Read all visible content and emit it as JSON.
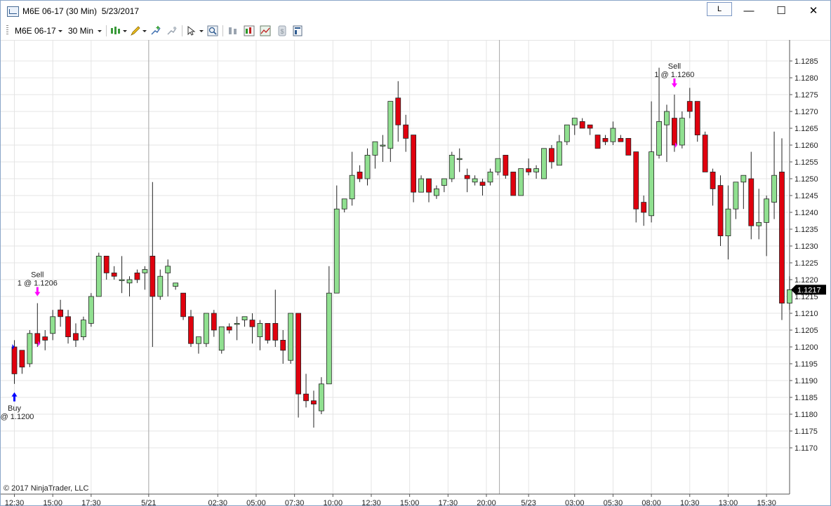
{
  "window": {
    "title": "M6E 06-17 (30 Min)  5/23/2017",
    "link_button": "L",
    "minimize": "—",
    "maximize": "☐",
    "close": "✕"
  },
  "toolbar": {
    "instrument": "M6E 06-17",
    "interval": "30 Min",
    "icons": [
      "chart-style-icon",
      "drawing-tool-icon",
      "add-indicator-icon",
      "strategy-icon",
      "cursor-icon",
      "zoom-icon",
      "bar-spacing-icon",
      "data-series-icon",
      "templates-icon",
      "trade-icon",
      "properties-icon"
    ]
  },
  "copyright": "© 2017 NinjaTrader, LLC",
  "colors": {
    "up": "#90e090",
    "down": "#e0000e",
    "outline": "#222222",
    "grid": "#e4e4e4",
    "marker_sell": "#ff00ff",
    "marker_buy": "#0000ff"
  },
  "chart_data": {
    "type": "candlestick",
    "title": "",
    "xlabel": "",
    "ylabel": "",
    "ylim": [
      1.1168,
      1.1292
    ],
    "y_ticks": [
      "1.1285",
      "1.1280",
      "1.1275",
      "1.1270",
      "1.1265",
      "1.1260",
      "1.1255",
      "1.1250",
      "1.1245",
      "1.1240",
      "1.1235",
      "1.1230",
      "1.1225",
      "1.1220",
      "1.1215",
      "1.1210",
      "1.1205",
      "1.1200",
      "1.1195",
      "1.1190",
      "1.1185",
      "1.1180",
      "1.1175",
      "1.1170"
    ],
    "x_ticks": [
      "12:30",
      "15:00",
      "17:30",
      "5/21",
      "02:30",
      "05:00",
      "07:30",
      "10:00",
      "12:30",
      "15:00",
      "17:30",
      "20:00",
      "5/23",
      "03:00",
      "05:30",
      "08:00",
      "10:30",
      "13:00",
      "15:30"
    ],
    "current_price": "1.1217",
    "candles": [
      [
        1.12,
        1.1202,
        1.1189,
        1.1192
      ],
      [
        1.1199,
        1.1199,
        1.1192,
        1.1194
      ],
      [
        1.1195,
        1.1205,
        1.1194,
        1.1204
      ],
      [
        1.1204,
        1.1213,
        1.12,
        1.1201
      ],
      [
        1.1203,
        1.1205,
        1.1199,
        1.1202
      ],
      [
        1.1204,
        1.1211,
        1.1202,
        1.1209
      ],
      [
        1.1211,
        1.1214,
        1.1206,
        1.1209
      ],
      [
        1.1209,
        1.1211,
        1.1201,
        1.1203
      ],
      [
        1.1204,
        1.1207,
        1.12,
        1.1202
      ],
      [
        1.1203,
        1.1209,
        1.1202,
        1.1208
      ],
      [
        1.1207,
        1.1216,
        1.1206,
        1.1215
      ],
      [
        1.1215,
        1.1228,
        1.1215,
        1.1227
      ],
      [
        1.1227,
        1.1227,
        1.122,
        1.1222
      ],
      [
        1.1222,
        1.1224,
        1.122,
        1.1221
      ],
      [
        1.122,
        1.1227,
        1.1216,
        1.122
      ],
      [
        1.1219,
        1.1221,
        1.1215,
        1.122
      ],
      [
        1.1222,
        1.1223,
        1.1219,
        1.122
      ],
      [
        1.1222,
        1.1224,
        1.1217,
        1.1223
      ],
      [
        1.1227,
        1.1249,
        1.12,
        1.1215
      ],
      [
        1.1215,
        1.1223,
        1.1214,
        1.1221
      ],
      [
        1.1222,
        1.1226,
        1.1215,
        1.1224
      ],
      [
        1.1218,
        1.1219,
        1.1217,
        1.1219
      ],
      [
        1.1216,
        1.1216,
        1.1208,
        1.1209
      ],
      [
        1.1209,
        1.1211,
        1.12,
        1.1201
      ],
      [
        1.1201,
        1.1203,
        1.1198,
        1.1203
      ],
      [
        1.1201,
        1.121,
        1.12,
        1.121
      ],
      [
        1.121,
        1.1211,
        1.1203,
        1.1205
      ],
      [
        1.1199,
        1.1205,
        1.1198,
        1.1206
      ],
      [
        1.1206,
        1.1207,
        1.1204,
        1.1205
      ],
      [
        1.1207,
        1.1209,
        1.1202,
        1.1207
      ],
      [
        1.1208,
        1.1209,
        1.1206,
        1.1209
      ],
      [
        1.1208,
        1.121,
        1.1201,
        1.1206
      ],
      [
        1.1203,
        1.1208,
        1.1199,
        1.1207
      ],
      [
        1.1207,
        1.1207,
        1.1201,
        1.1202
      ],
      [
        1.1207,
        1.1217,
        1.12,
        1.1202
      ],
      [
        1.1202,
        1.1205,
        1.1195,
        1.1199
      ],
      [
        1.1196,
        1.121,
        1.1195,
        1.121
      ],
      [
        1.121,
        1.121,
        1.1179,
        1.1186
      ],
      [
        1.1186,
        1.1192,
        1.1182,
        1.1184
      ],
      [
        1.1184,
        1.1187,
        1.1176,
        1.1183
      ],
      [
        1.1181,
        1.1191,
        1.118,
        1.1189
      ],
      [
        1.1189,
        1.1224,
        1.1189,
        1.1216
      ],
      [
        1.1216,
        1.1248,
        1.1216,
        1.1241
      ],
      [
        1.1241,
        1.1244,
        1.124,
        1.1244
      ],
      [
        1.1244,
        1.1258,
        1.1242,
        1.1251
      ],
      [
        1.1252,
        1.1254,
        1.1249,
        1.125
      ],
      [
        1.125,
        1.1259,
        1.1248,
        1.1257
      ],
      [
        1.1257,
        1.1261,
        1.1253,
        1.1261
      ],
      [
        1.126,
        1.1263,
        1.1255,
        1.126
      ],
      [
        1.1259,
        1.1273,
        1.1255,
        1.1273
      ],
      [
        1.1274,
        1.1279,
        1.1261,
        1.1266
      ],
      [
        1.1266,
        1.1269,
        1.1258,
        1.1262
      ],
      [
        1.1263,
        1.1263,
        1.1243,
        1.1246
      ],
      [
        1.1246,
        1.1251,
        1.1246,
        1.125
      ],
      [
        1.125,
        1.125,
        1.1243,
        1.1246
      ],
      [
        1.1245,
        1.1248,
        1.1244,
        1.1247
      ],
      [
        1.1248,
        1.125,
        1.1246,
        1.125
      ],
      [
        1.125,
        1.1258,
        1.1249,
        1.1257
      ],
      [
        1.1256,
        1.1259,
        1.1252,
        1.1256
      ],
      [
        1.1251,
        1.1253,
        1.1246,
        1.125
      ],
      [
        1.1249,
        1.1251,
        1.1248,
        1.125
      ],
      [
        1.1249,
        1.125,
        1.1245,
        1.1248
      ],
      [
        1.1249,
        1.1253,
        1.1248,
        1.1252
      ],
      [
        1.1252,
        1.1256,
        1.1251,
        1.1256
      ],
      [
        1.1257,
        1.1257,
        1.125,
        1.1251
      ],
      [
        1.1252,
        1.1252,
        1.1245,
        1.1245
      ],
      [
        1.1245,
        1.1253,
        1.1245,
        1.1253
      ],
      [
        1.1253,
        1.1256,
        1.1251,
        1.1252
      ],
      [
        1.1252,
        1.1254,
        1.125,
        1.1253
      ],
      [
        1.125,
        1.1259,
        1.125,
        1.1259
      ],
      [
        1.1259,
        1.126,
        1.1253,
        1.1255
      ],
      [
        1.1254,
        1.1263,
        1.1254,
        1.1261
      ],
      [
        1.1261,
        1.1266,
        1.126,
        1.1266
      ],
      [
        1.1266,
        1.1267,
        1.1263,
        1.1268
      ],
      [
        1.1267,
        1.1268,
        1.1265,
        1.1265
      ],
      [
        1.1266,
        1.1266,
        1.1263,
        1.1265
      ],
      [
        1.1263,
        1.1263,
        1.1259,
        1.1259
      ],
      [
        1.1262,
        1.1263,
        1.126,
        1.1261
      ],
      [
        1.1261,
        1.1267,
        1.126,
        1.1265
      ],
      [
        1.1262,
        1.1263,
        1.1261,
        1.1261
      ],
      [
        1.1262,
        1.1262,
        1.1257,
        1.1257
      ],
      [
        1.1258,
        1.1258,
        1.1237,
        1.1241
      ],
      [
        1.1243,
        1.1245,
        1.1236,
        1.124
      ],
      [
        1.1239,
        1.1273,
        1.1237,
        1.1258
      ],
      [
        1.1257,
        1.1283,
        1.1256,
        1.1267
      ],
      [
        1.1266,
        1.1272,
        1.1255,
        1.127
      ],
      [
        1.1268,
        1.1275,
        1.1258,
        1.126
      ],
      [
        1.126,
        1.127,
        1.1259,
        1.1268
      ],
      [
        1.1273,
        1.1277,
        1.1268,
        1.127
      ],
      [
        1.1273,
        1.1273,
        1.1261,
        1.1263
      ],
      [
        1.1263,
        1.1264,
        1.1252,
        1.1252
      ],
      [
        1.1252,
        1.1253,
        1.1242,
        1.1247
      ],
      [
        1.1248,
        1.1251,
        1.123,
        1.1233
      ],
      [
        1.1233,
        1.1248,
        1.1226,
        1.1241
      ],
      [
        1.1241,
        1.1249,
        1.1238,
        1.1249
      ],
      [
        1.1249,
        1.125,
        1.1241,
        1.1251
      ],
      [
        1.125,
        1.1258,
        1.1232,
        1.1236
      ],
      [
        1.1236,
        1.1247,
        1.1232,
        1.1237
      ],
      [
        1.1237,
        1.1245,
        1.1227,
        1.1244
      ],
      [
        1.1243,
        1.1264,
        1.1238,
        1.1251
      ],
      [
        1.1252,
        1.1262,
        1.1208,
        1.1213
      ],
      [
        1.1213,
        1.1221,
        1.1211,
        1.1217
      ]
    ],
    "markers": [
      {
        "kind": "buy",
        "candle": 0,
        "label_top": "Buy",
        "label_bottom": "@ 1.1200"
      },
      {
        "kind": "sell",
        "candle": 3,
        "label_top": "Sell",
        "label_bottom": "1 @ 1.1206"
      },
      {
        "kind": "sell",
        "candle": 86,
        "label_top": "Sell",
        "label_bottom": "1 @ 1.1260"
      }
    ]
  }
}
